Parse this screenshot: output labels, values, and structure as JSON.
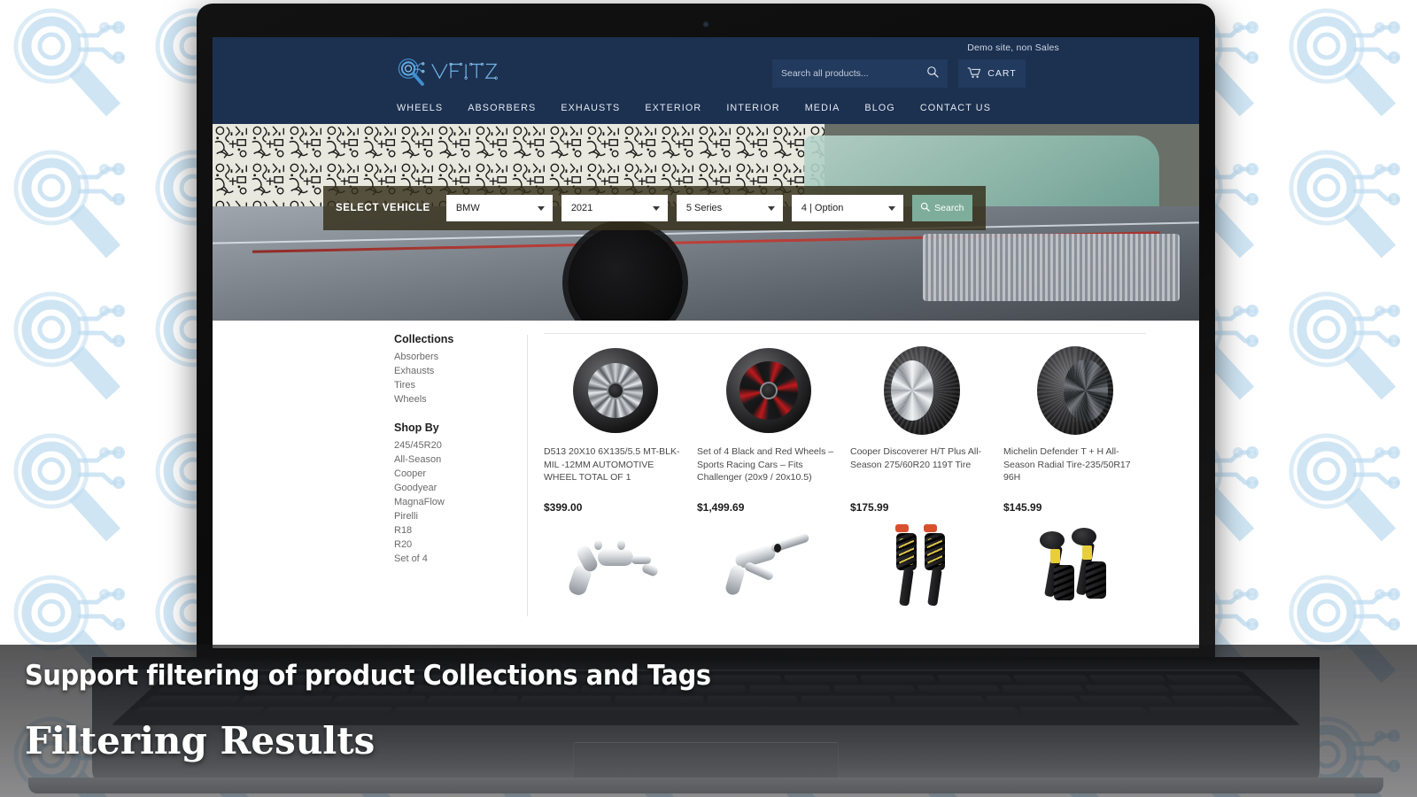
{
  "site": {
    "demo_note": "Demo site, non Sales",
    "logo_text": "VFITZ",
    "logo_icon": "magnifier-circuit-icon"
  },
  "search": {
    "placeholder": "Search all products...",
    "value": "",
    "icon": "search-icon"
  },
  "cart": {
    "label": "CART",
    "icon": "shopping-cart-icon"
  },
  "nav": {
    "items": [
      {
        "label": "WHEELS"
      },
      {
        "label": "ABSORBERS"
      },
      {
        "label": "EXHAUSTS"
      },
      {
        "label": "EXTERIOR"
      },
      {
        "label": "INTERIOR"
      },
      {
        "label": "MEDIA"
      },
      {
        "label": "BLOG"
      },
      {
        "label": "CONTACT US"
      }
    ]
  },
  "vehicle_selector": {
    "label": "SELECT VEHICLE",
    "make": "BMW",
    "year": "2021",
    "model": "5 Series",
    "option": "4 | Option",
    "search_button": "Search",
    "search_icon": "search-icon"
  },
  "sidebar": {
    "collections_title": "Collections",
    "collections": [
      {
        "label": "Absorbers"
      },
      {
        "label": "Exhausts"
      },
      {
        "label": "Tires"
      },
      {
        "label": "Wheels"
      }
    ],
    "shopby_title": "Shop By",
    "tags": [
      {
        "label": "245/45R20"
      },
      {
        "label": "All-Season"
      },
      {
        "label": "Cooper"
      },
      {
        "label": "Goodyear"
      },
      {
        "label": "MagnaFlow"
      },
      {
        "label": "Pirelli"
      },
      {
        "label": "R18"
      },
      {
        "label": "R20"
      },
      {
        "label": "Set of 4"
      }
    ]
  },
  "products": {
    "row1": [
      {
        "title": "D513 20X10 6X135/5.5 MT-BLK-MIL -12MM AUTOMOTIVE WHEEL TOTAL OF 1",
        "price": "$399.00",
        "image": "black-milled-offroad-wheel"
      },
      {
        "title": "Set of 4 Black and Red Wheels – Sports Racing Cars – Fits Challenger (20x9 / 20x10.5)",
        "price": "$1,499.69",
        "image": "black-red-racing-wheel"
      },
      {
        "title": "Cooper Discoverer H/T Plus All-Season 275/60R20 119T Tire",
        "price": "$175.99",
        "image": "cooper-discoverer-tire"
      },
      {
        "title": "Michelin Defender T + H All- Season Radial Tire-235/50R17 96H",
        "price": "$145.99",
        "image": "michelin-defender-tire"
      }
    ],
    "row2": [
      {
        "image": "chrome-exhaust-system-1"
      },
      {
        "image": "chrome-exhaust-system-2"
      },
      {
        "image": "coilover-shock-pair-red-cap"
      },
      {
        "image": "coilover-shock-pair-yellow"
      }
    ]
  },
  "captions": {
    "line1": "Support filtering of  product Collections and Tags",
    "line2": "Filtering Results"
  },
  "colors": {
    "header_bg": "#1c3050",
    "search_field_bg": "#223a5e",
    "selector_bar_bg": "#342e1a",
    "selector_search_btn": "#7ead9b",
    "watermark": "#bfdcf0",
    "caption_text": "#ffffff"
  }
}
